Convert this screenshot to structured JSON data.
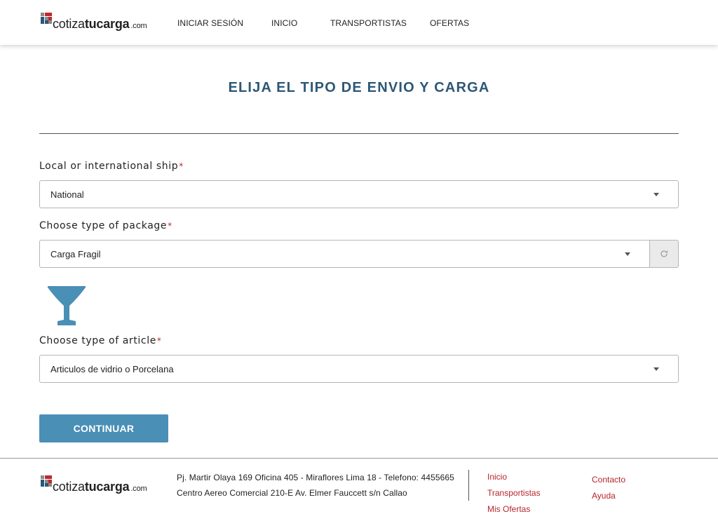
{
  "brand": {
    "light": "cotiza",
    "bold": "tucarga",
    "tld": ".com",
    "colors": {
      "red": "#c0272d",
      "blue": "#2d5776",
      "gray": "#8a8a8a"
    }
  },
  "nav": {
    "login": "INICIAR SESIÓN",
    "home": "INICIO",
    "carriers": "TRANSPORTISTAS",
    "offers": "OFERTAS"
  },
  "page": {
    "title": "ELIJA EL TIPO DE ENVIO Y CARGA"
  },
  "form": {
    "ship": {
      "label": "Local or international ship",
      "required": "*",
      "value": "National"
    },
    "package": {
      "label": "Choose type of package",
      "required": "*",
      "value": "Carga Fragil",
      "refresh_icon": "refresh-icon"
    },
    "article_icon": "wine-glass-icon",
    "article": {
      "label": "Choose type of article",
      "required": "*",
      "value": "Articulos de vidrio o Porcelana"
    },
    "submit": "CONTINUAR"
  },
  "footer": {
    "address1": "Pj. Martir Olaya 169 Oficina 405 - Miraflores Lima 18 - Telefono: 4455665",
    "address2": "Centro Aereo Comercial 210-E Av. Elmer Fauccett s/n Callao",
    "links_col1": [
      "Inicio",
      "Transportistas",
      "Mis Ofertas"
    ],
    "links_col2": [
      "Contacto",
      "Ayuda"
    ]
  },
  "colors": {
    "accent": "#4a8fb5",
    "title": "#2d5776",
    "footer_link": "#b5252b",
    "required": "#c0272d"
  }
}
